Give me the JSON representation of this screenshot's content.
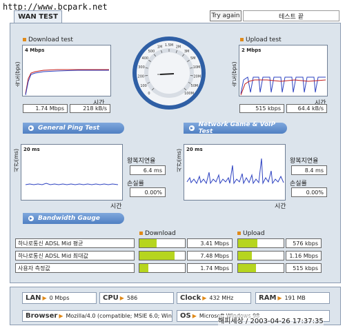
{
  "watermark_top": "http://www.bcpark.net",
  "tab_label": "WAN TEST",
  "try_again_label": "Try again",
  "test_status": "테스트 끝",
  "download": {
    "title": "Download test",
    "axis_label": "속도(bps)",
    "scale": "4 Mbps",
    "time_label": "시간",
    "speed": "1.74 Mbps",
    "rate": "218 kB/s"
  },
  "upload": {
    "title": "Upload test",
    "axis_label": "속도(bps)",
    "scale": "2 Mbps",
    "time_label": "시간",
    "speed": "515 kbps",
    "rate": "64.4 kB/s"
  },
  "gauge": {
    "ticks": [
      "0",
      "100",
      "200",
      "300",
      "400",
      "500",
      "1M",
      "1.5M",
      "2M",
      "3M",
      "5M",
      "10M",
      "20M",
      "50M",
      "100M"
    ]
  },
  "ping_section": "General Ping Test",
  "game_section": "Network Game & VoIP Test",
  "ping": {
    "axis_label": "시간(ms)",
    "scale": "20 ms",
    "time_label": "시간",
    "rtt_label": "왕복지연율",
    "rtt": "6.4 ms",
    "loss_label": "손실률",
    "loss": "0.00%"
  },
  "game": {
    "axis_label": "시간(ms)",
    "scale": "20 ms",
    "time_label": "시간",
    "rtt_label": "왕복지연율",
    "rtt": "8.4 ms",
    "loss_label": "손실률",
    "loss": "0.00%"
  },
  "bandwidth_section": "Bandwidth Gauge",
  "bandwidth": {
    "download_header": "Download",
    "upload_header": "Upload",
    "rows": [
      {
        "label": "하나로통신 ADSL Mid 평균",
        "down": "3.41 Mbps",
        "down_fill": 0.38,
        "up": "576 kbps",
        "up_fill": 0.42
      },
      {
        "label": "하나로통신 ADSL Mid 최대값",
        "down": "7.48 Mbps",
        "down_fill": 0.78,
        "up": "1.16 Mbps",
        "up_fill": 0.3
      },
      {
        "label": "사용자 측정값",
        "down": "1.74 Mbps",
        "down_fill": 0.2,
        "up": "515 kbps",
        "up_fill": 0.4
      }
    ]
  },
  "info": {
    "lan_key": "LAN",
    "lan_val": "0 Mbps",
    "cpu_key": "CPU",
    "cpu_val": "586",
    "clock_key": "Clock",
    "clock_val": "432 MHz",
    "ram_key": "RAM",
    "ram_val": "191 MB",
    "browser_key": "Browser",
    "browser_val": "Mozilla/4.0 (compatible; MSIE 6.0; Window",
    "os_key": "OS",
    "os_val": "Microsoft Windows 98"
  },
  "watermark_bottom": "해피세상 / 2003-04-26 17:37:35",
  "colors": {
    "accent": "#e08a1a",
    "bar_fill": "#b6d51f",
    "section_bar": "#5b88c9"
  }
}
